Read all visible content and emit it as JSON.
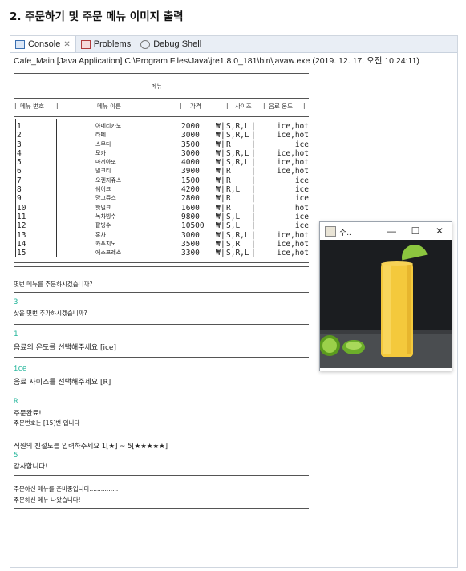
{
  "heading": "2. 주문하기 및 주문 메뉴 이미지 출력",
  "tabs": [
    {
      "label": "Console",
      "icon": "console-icon"
    },
    {
      "label": "Problems",
      "icon": "problems-icon"
    },
    {
      "label": "Debug Shell",
      "icon": "debug-icon"
    }
  ],
  "path": "Cafe_Main [Java Application] C:\\Program Files\\Java\\jre1.8.0_181\\bin\\javaw.exe (2019. 12. 17. 오전 10:24:11)",
  "menu_title": "메뉴",
  "columns": [
    "메뉴 번호",
    "메뉴 이름",
    "가격",
    "사이즈",
    "음료 온도"
  ],
  "menu": [
    {
      "no": "1",
      "name": "아메리카노",
      "price": "2000",
      "size": "S,R,L",
      "temp": "ice,hot"
    },
    {
      "no": "2",
      "name": "라떼",
      "price": "3000",
      "size": "S,R,L",
      "temp": "ice,hot"
    },
    {
      "no": "3",
      "name": "스무디",
      "price": "3500",
      "size": "R",
      "temp": "ice"
    },
    {
      "no": "4",
      "name": "모카",
      "price": "3000",
      "size": "S,R,L",
      "temp": "ice,hot"
    },
    {
      "no": "5",
      "name": "마끼아또",
      "price": "4000",
      "size": "S,R,L",
      "temp": "ice,hot"
    },
    {
      "no": "6",
      "name": "밀크티",
      "price": "3900",
      "size": "R",
      "temp": "ice,hot"
    },
    {
      "no": "7",
      "name": "오렌지쥬스",
      "price": "1500",
      "size": "R",
      "temp": "ice"
    },
    {
      "no": "8",
      "name": "쉐이크",
      "price": "4200",
      "size": "R,L",
      "temp": "ice"
    },
    {
      "no": "9",
      "name": "망고쥬스",
      "price": "2800",
      "size": "R",
      "temp": "ice"
    },
    {
      "no": "10",
      "name": "핫밀크",
      "price": "1600",
      "size": "R",
      "temp": "hot"
    },
    {
      "no": "11",
      "name": "녹차빙수",
      "price": "9800",
      "size": "S,L",
      "temp": "ice"
    },
    {
      "no": "12",
      "name": "팥빙수",
      "price": "10500",
      "size": "S,L",
      "temp": "ice"
    },
    {
      "no": "13",
      "name": "홍차",
      "price": "3000",
      "size": "S,R,L",
      "temp": "ice,hot"
    },
    {
      "no": "14",
      "name": "카푸치노",
      "price": "3500",
      "size": "S,R",
      "temp": "ice,hot"
    },
    {
      "no": "15",
      "name": "에스프레소",
      "price": "3300",
      "size": "S,R,L",
      "temp": "ice,hot"
    }
  ],
  "currency": "₩",
  "dialog": {
    "q1": "몇번 메뉴를 주문하시겠습니까?",
    "a1": "3",
    "q2": "샷을 몇번 추가하시겠습니까?",
    "a2": "1",
    "q3": "음료의 온도를 선택해주세요 [ice]",
    "a3": "ice",
    "q4": "음료 사이즈를 선택해주세요 [R]",
    "a4": "R",
    "done": "주문완료!",
    "order_no": "주문번호는 [15]번 입니다",
    "rate": "직원의 친절도를 입력하주세요 1[★] ~ 5[★★★★★]",
    "a5": "5",
    "thanks": "감사합니다!",
    "prep": "주문하신 메뉴를 준비중입니다...............",
    "ready": "주문하신 메뉴 나왔습니다!"
  },
  "image_window": {
    "title": "주..",
    "controls": [
      "—",
      "☐",
      "✕"
    ],
    "colors": {
      "drink": "#f4c93c",
      "lime": "#6cae2a",
      "background": "#1b1d20"
    }
  }
}
